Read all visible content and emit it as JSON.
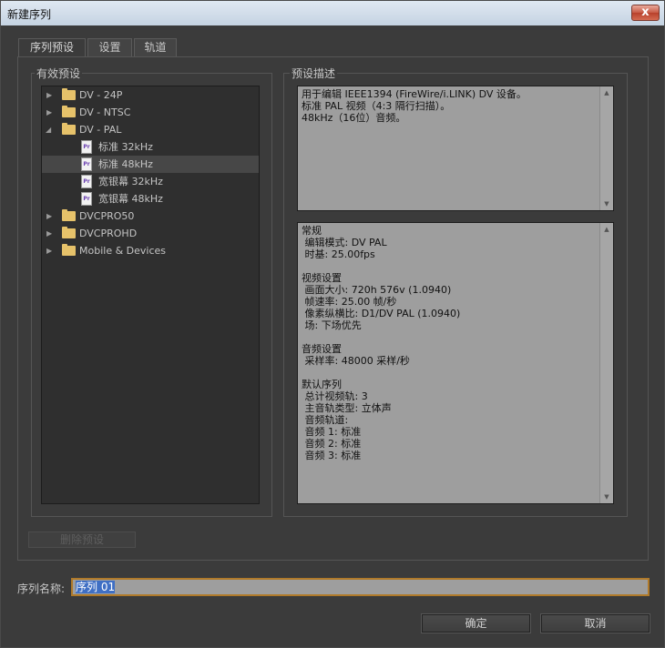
{
  "window": {
    "title": "新建序列",
    "close_label": "x"
  },
  "tabs": [
    {
      "label": "序列预设"
    },
    {
      "label": "设置"
    },
    {
      "label": "轨道"
    }
  ],
  "presets": {
    "group_label": "有效预设",
    "items": [
      {
        "label": "DV - 24P",
        "type": "folder",
        "expanded": false
      },
      {
        "label": "DV - NTSC",
        "type": "folder",
        "expanded": false
      },
      {
        "label": "DV - PAL",
        "type": "folder",
        "expanded": true
      },
      {
        "label": "标准 32kHz",
        "type": "file",
        "selected": false
      },
      {
        "label": "标准 48kHz",
        "type": "file",
        "selected": true
      },
      {
        "label": "宽银幕 32kHz",
        "type": "file",
        "selected": false
      },
      {
        "label": "宽银幕 48kHz",
        "type": "file",
        "selected": false
      },
      {
        "label": "DVCPRO50",
        "type": "folder",
        "expanded": false
      },
      {
        "label": "DVCPROHD",
        "type": "folder",
        "expanded": false
      },
      {
        "label": "Mobile & Devices",
        "type": "folder",
        "expanded": false
      }
    ],
    "file_icon_text": "Pr"
  },
  "description": {
    "group_label": "预设描述",
    "summary": "用于编辑 IEEE1394 (FireWire/i.LINK) DV 设备。\n标准 PAL 视频（4:3 隔行扫描）。\n48kHz（16位）音频。",
    "details": "常规\n 编辑模式: DV PAL\n 时基: 25.00fps\n\n视频设置\n 画面大小: 720h 576v (1.0940)\n 帧速率: 25.00 帧/秒\n 像素纵横比: D1/DV PAL (1.0940)\n 场: 下场优先\n\n音频设置\n 采样率: 48000 采样/秒\n\n默认序列\n 总计视频轨: 3\n 主音轨类型: 立体声\n 音频轨道:\n 音频 1: 标准\n 音频 2: 标准\n 音频 3: 标准"
  },
  "delete_preset_label": "删除预设",
  "sequence_name": {
    "label": "序列名称:",
    "value": "序列 01"
  },
  "ok_label": "确定",
  "cancel_label": "取消",
  "colors": {
    "folder": "#e6c26a",
    "selection": "#3f6fc4",
    "focus_border": "#b07a2a"
  }
}
